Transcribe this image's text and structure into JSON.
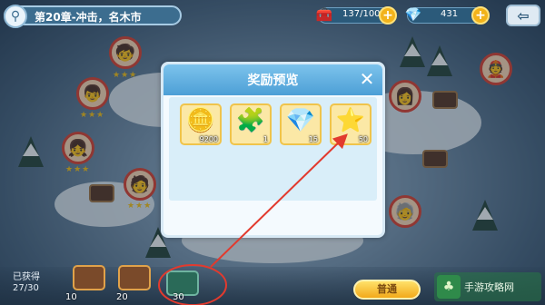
{
  "top_bar": {
    "chapter_title": "第20章-冲击，名木市",
    "stamina": "137/100",
    "gems": "431",
    "back_icon": "back-arrow-icon"
  },
  "modal": {
    "title": "奖励预览",
    "close_icon": "close-icon",
    "rewards": [
      {
        "icon": "gold-coin-icon",
        "count": "9200"
      },
      {
        "icon": "puzzle-piece-icon",
        "count": "1"
      },
      {
        "icon": "crystal-icon",
        "count": "15"
      },
      {
        "icon": "star-icon",
        "count": "50"
      }
    ]
  },
  "bottom_bar": {
    "obtained_label": "已获得",
    "obtained_value": "27/30",
    "chests": [
      {
        "count": "10"
      },
      {
        "count": "20"
      },
      {
        "count": "30"
      }
    ],
    "difficulty_button": "普通"
  },
  "watermark": {
    "text": "手游攻略网"
  },
  "colors": {
    "modal_header": "#4d9fd6",
    "reward_bg": "#fbe8a6",
    "annotation": "#e23a2e",
    "gold_button": "#f2a91a"
  }
}
